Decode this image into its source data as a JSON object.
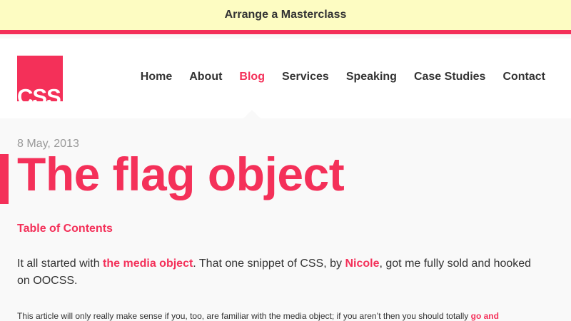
{
  "banner": {
    "text": "Arrange a Masterclass"
  },
  "header": {
    "logo_text": "CSS",
    "nav": [
      {
        "label": "Home"
      },
      {
        "label": "About"
      },
      {
        "label": "Blog",
        "active": true
      },
      {
        "label": "Services"
      },
      {
        "label": "Speaking"
      },
      {
        "label": "Case Studies"
      },
      {
        "label": "Contact"
      }
    ]
  },
  "article": {
    "date": "8 May, 2013",
    "title": "The flag object",
    "toc_label": "Table of Contents",
    "intro": {
      "part1": "It all started with ",
      "link1": "the media object",
      "part2": ". That one snippet of CSS, by ",
      "link2": "Nicole",
      "part3": ", got me fully sold and hooked on OOCSS."
    },
    "note": {
      "text": "This article will only really make sense if you, too, are familiar with the media object; if you aren’t then you should totally ",
      "link": "go and"
    }
  },
  "colors": {
    "accent": "#f43059",
    "banner_bg": "#fdfcc2",
    "text": "#333333",
    "muted": "#999999",
    "page_bg": "#f9f9f9"
  }
}
